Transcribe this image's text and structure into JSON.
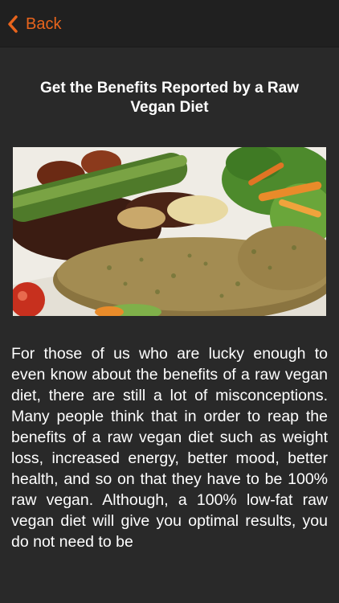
{
  "nav": {
    "back_label": "Back",
    "back_icon": "chevron-left-icon",
    "accent_color": "#e8641c",
    "bar_color": "#202020"
  },
  "article": {
    "title": "Get the Benefits Reported by a Raw Vegan Diet",
    "image": "raw-vegan-food-photo",
    "body": "For those of us who are lucky enough to even know about the benefits of a raw vegan diet, there are still a lot of misconceptions. Many people think that in order to reap the benefits of a raw vegan diet such as weight loss, increased energy, better mood, better health, and so on that they have to be 100% raw vegan. Although, a 100% low-fat raw vegan diet will give you optimal results, you do not need to be"
  },
  "colors": {
    "background": "#292929",
    "text": "#ffffff"
  }
}
